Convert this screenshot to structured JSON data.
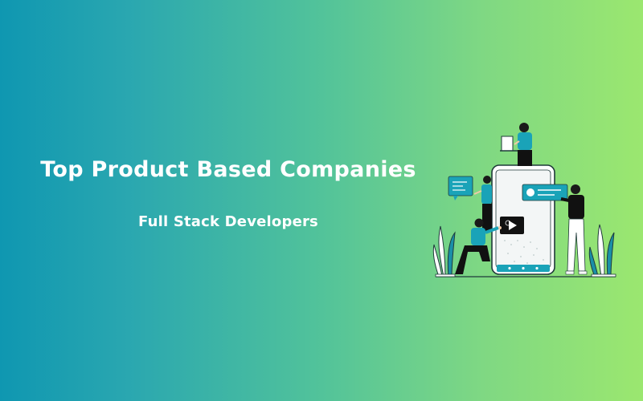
{
  "banner": {
    "title": "Top Product Based Companies",
    "subtitle": "Full Stack Developers",
    "colors": {
      "gradient_start": "#0f97b1",
      "gradient_end": "#9be76f",
      "text": "#ffffff",
      "accent_teal": "#1aa3b8",
      "figure_dark": "#111111"
    },
    "illustration": {
      "icons": [
        "smartphone-icon",
        "play-button-icon",
        "chat-bubble-icon",
        "message-card-icon",
        "laptop-icon",
        "plant-icon"
      ]
    }
  }
}
